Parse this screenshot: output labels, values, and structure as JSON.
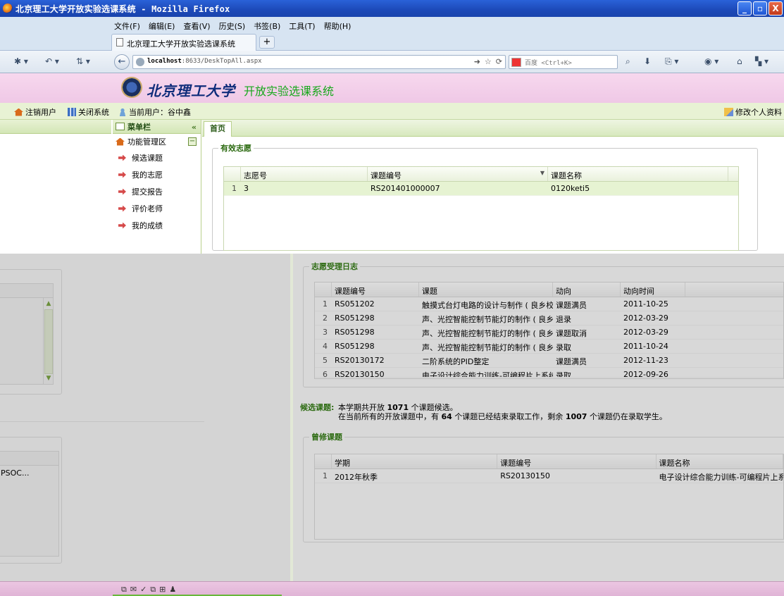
{
  "browser": {
    "window_title": "北京理工大学开放实验选课系统 - Mozilla Firefox",
    "menus": [
      "文件(F)",
      "编辑(E)",
      "查看(V)",
      "历史(S)",
      "书签(B)",
      "工具(T)",
      "帮助(H)"
    ],
    "tab_title": "北京理工大学开放实验选课系统",
    "new_tab": "+",
    "url_host": "localhost",
    "url_rest": ":8633/DeskTopAll.aspx",
    "search_engine_placeholder": "百度 <Ctrl+K>",
    "win_buttons": [
      "_",
      "▫",
      "X"
    ]
  },
  "site": {
    "school_name": "北京理工大学",
    "system_name": "开放实验选课系统"
  },
  "userbar": {
    "logout": "注销用户",
    "close_system": "关闭系统",
    "current_user": "当前用户：谷中鑫",
    "edit_profile": "修改个人资料"
  },
  "sidebar": {
    "title": "菜单栏",
    "collapse": "«",
    "group": "功能管理区",
    "group_toggle": "−",
    "items": [
      {
        "label": "候选课题"
      },
      {
        "label": "我的志愿"
      },
      {
        "label": "提交报告"
      },
      {
        "label": "评价老师"
      },
      {
        "label": "我的成绩"
      }
    ]
  },
  "main": {
    "tab_home": "首页",
    "wishes": {
      "legend": "有效志愿",
      "columns": [
        "志愿号",
        "课题编号",
        "课题名称"
      ],
      "rows": [
        {
          "n": "1",
          "wish_no": "3",
          "code": "RS201401000007",
          "name": "0120keti5"
        }
      ]
    },
    "log": {
      "legend": "志愿受理日志",
      "columns": [
        "课题编号",
        "课题",
        "动向",
        "动向时间"
      ],
      "rows": [
        {
          "n": "1",
          "code": "RS051202",
          "topic": "触摸式台灯电路的设计与制作 ( 良乡校区",
          "action": "课题满员",
          "time": "2011-10-25"
        },
        {
          "n": "2",
          "code": "RS051298",
          "topic": "声、光控智能控制节能灯的制作 ( 良乡 )",
          "action": "退录",
          "time": "2012-03-29"
        },
        {
          "n": "3",
          "code": "RS051298",
          "topic": "声、光控智能控制节能灯的制作 ( 良乡 )",
          "action": "课题取消",
          "time": "2012-03-29"
        },
        {
          "n": "4",
          "code": "RS051298",
          "topic": "声、光控智能控制节能灯的制作 ( 良乡 )",
          "action": "录取",
          "time": "2011-10-24"
        },
        {
          "n": "5",
          "code": "RS20130172",
          "topic": "二阶系统的PID整定",
          "action": "课题满员",
          "time": "2012-11-23"
        },
        {
          "n": "6",
          "code": "RS20130150",
          "topic": "电子设计综合能力训练-可编程片上系统",
          "action": "录取",
          "time": "2012-09-26"
        }
      ]
    },
    "candidates": {
      "label": "候选课题:",
      "line1_pre": "本学期共开放",
      "line1_num": "1071",
      "line1_post": "个课题候选。",
      "line2_pre": "在当前所有的开放课题中，有",
      "line2_num1": "64",
      "line2_mid": "个课题已经结束录取工作，剩余",
      "line2_num2": "1007",
      "line2_post": "个课题仍在录取学生。"
    },
    "taken": {
      "legend": "曾修课题",
      "columns": [
        "学期",
        "课题编号",
        "课题名称"
      ],
      "rows": [
        {
          "n": "1",
          "term": "2012年秋季",
          "code": "RS20130150",
          "name": "电子设计综合能力训练-可编程片上系统"
        }
      ]
    },
    "left_partial_cell": "PSOC..."
  },
  "status_icons": [
    "⧉",
    "✉",
    "✓",
    "⧉",
    "⊞",
    "♟"
  ],
  "colors": {
    "accent_green": "#2d6b12",
    "banner_pink": "#f7d8ee",
    "titlebar_blue": "#2a62d8"
  }
}
